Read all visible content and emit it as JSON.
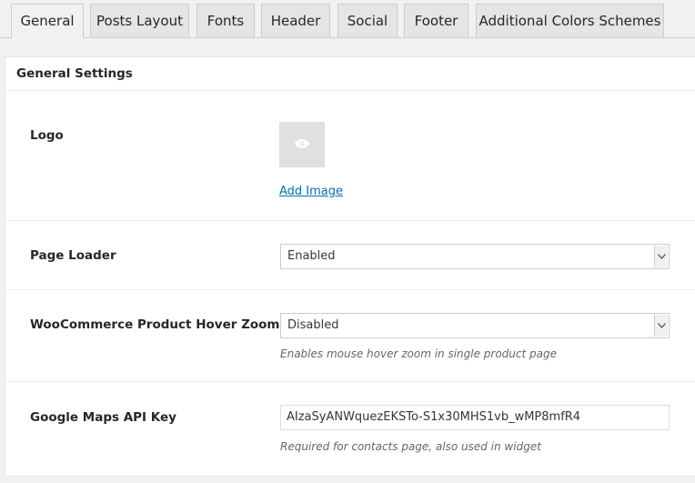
{
  "tabs": [
    {
      "label": "General",
      "active": true
    },
    {
      "label": "Posts Layout",
      "active": false
    },
    {
      "label": "Fonts",
      "active": false
    },
    {
      "label": "Header",
      "active": false
    },
    {
      "label": "Social",
      "active": false
    },
    {
      "label": "Footer",
      "active": false
    },
    {
      "label": "Additional Colors Schemes",
      "active": false
    }
  ],
  "panel": {
    "title": "General Settings"
  },
  "settings": {
    "logo": {
      "label": "Logo",
      "icon": "eye-icon",
      "add_image_label": "Add Image"
    },
    "page_loader": {
      "label": "Page Loader",
      "value": "Enabled"
    },
    "woo_zoom": {
      "label": "WooCommerce Product Hover Zoom",
      "value": "Disabled",
      "description": "Enables mouse hover zoom in single product page"
    },
    "maps_key": {
      "label": "Google Maps API Key",
      "value": "AIzaSyANWquezEKSTo-S1x30MHS1vb_wMP8mfR4",
      "description": "Required for contacts page, also used in widget"
    }
  },
  "colors": {
    "link": "#0073aa",
    "tab_active_bg": "#f1f1f1",
    "tab_bg": "#e5e5e5"
  }
}
